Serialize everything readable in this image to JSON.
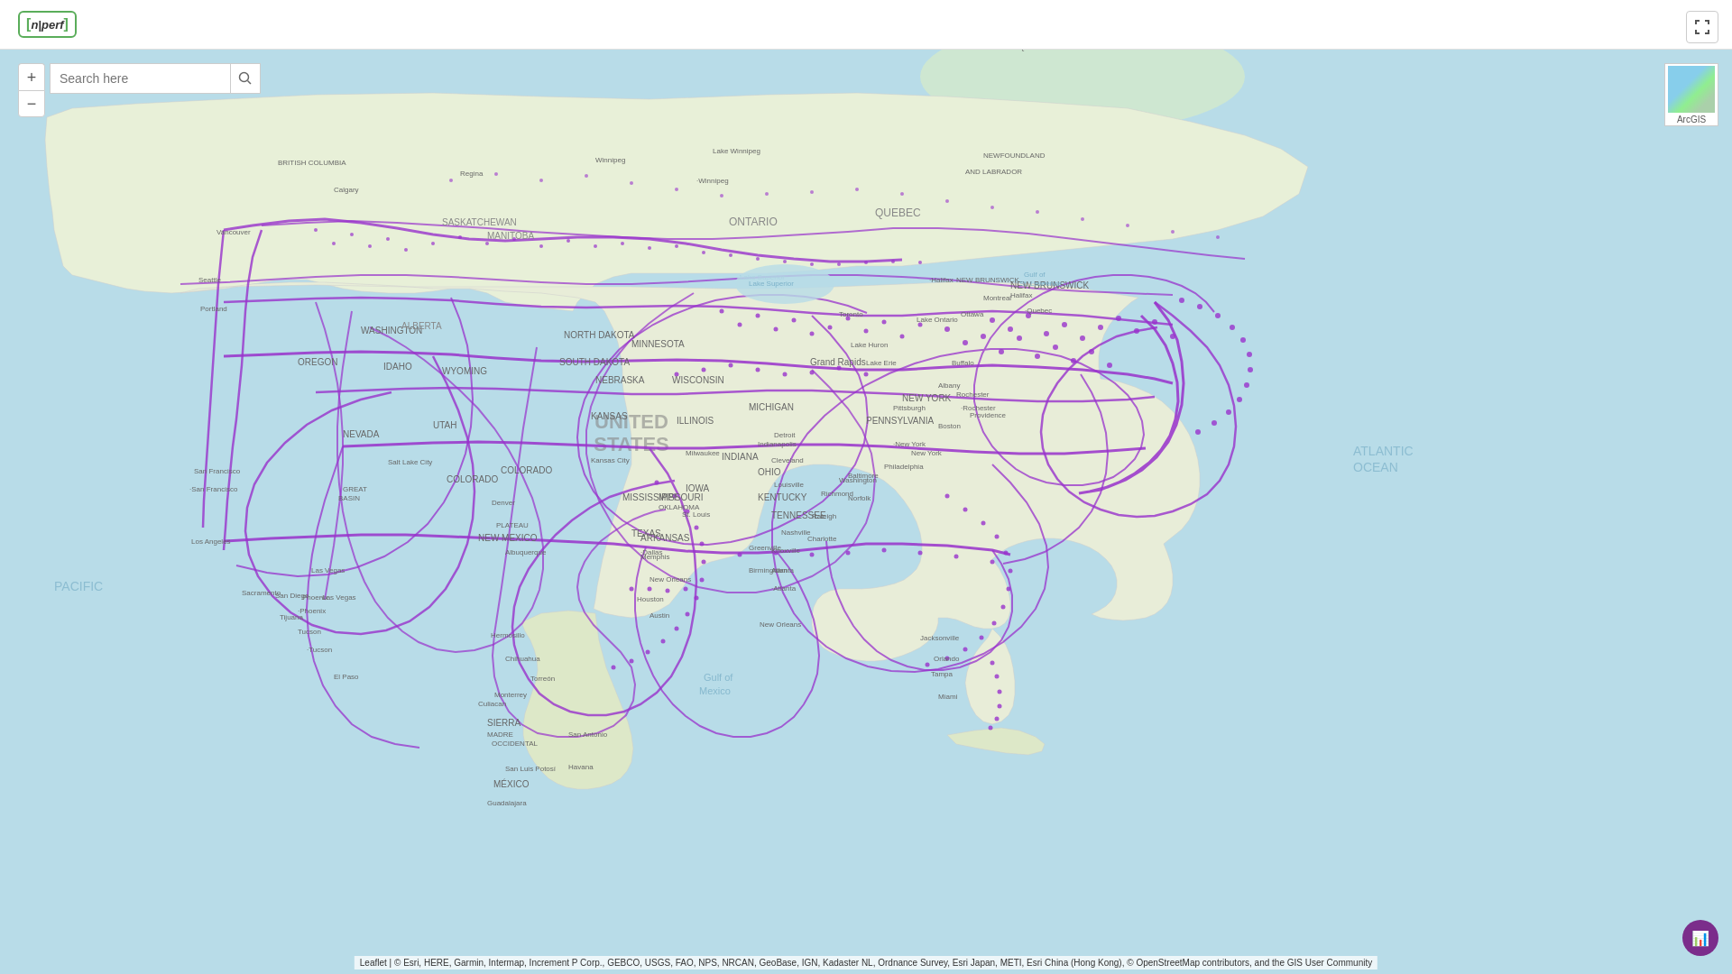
{
  "header": {
    "logo_bracket_open": "[",
    "logo_bracket_close": "]",
    "logo_text": "n|perf"
  },
  "search": {
    "placeholder": "Search here"
  },
  "zoom": {
    "zoom_in_label": "+",
    "zoom_out_label": "−"
  },
  "arcgis": {
    "label": "ArcGIS"
  },
  "attribution": {
    "text": "Leaflet | © Esri, HERE, Garmin, Intermap, Increment P Corp., GEBCO, USGS, FAO, NPS, NRCAN, GeoBase, IGN, Kadaster NL, Ordnance Survey, Esri Japan, METI, Esri China (Hong Kong), © OpenStreetMap contributors, and the GIS User Community"
  },
  "fullscreen": {
    "label": "⛶"
  }
}
